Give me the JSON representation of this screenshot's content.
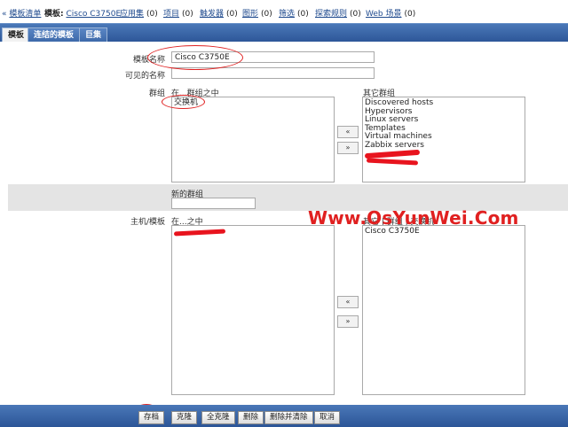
{
  "breadcrumb": {
    "template_list_link": "模板清单",
    "template_prefix": "模板:",
    "template_name_link": "Cisco C3750E",
    "applications": {
      "label": "应用集",
      "count": "(0)"
    },
    "items": {
      "label": "项目",
      "count": "(0)"
    },
    "triggers": {
      "label": "触发器",
      "count": "(0)"
    },
    "graphs": {
      "label": "图形",
      "count": "(0)"
    },
    "screens": {
      "label": "筛选",
      "count": "(0)"
    },
    "discovery": {
      "label": "探索规则",
      "count": "(0)"
    },
    "web": {
      "label": "Web 场景",
      "count": "(0)"
    }
  },
  "tabs": [
    {
      "label": "模板"
    },
    {
      "label": "连结的模板"
    },
    {
      "label": "巨集"
    }
  ],
  "form": {
    "template_name_label": "模板名称",
    "template_name_value": "Cisco C3750E",
    "visible_name_label": "可见的名称",
    "visible_name_value": "",
    "groups_label": "群组",
    "in_groups_label": "在...群组之中",
    "in_groups": [
      "交换机"
    ],
    "other_groups_label": "其它群组",
    "other_groups": [
      "Discovered hosts",
      "Hypervisors",
      "Linux servers",
      "Templates",
      "Virtual machines",
      "Zabbix servers"
    ],
    "move_left": "«",
    "move_right": "»",
    "new_group_label": "新的群组",
    "new_group_value": "",
    "hosts_label": "主机/模板",
    "in_hosts_label": "在...之中",
    "other_hosts_label": "其它 | 群组 | 交换机",
    "other_hosts": [
      "Cisco C3750E"
    ]
  },
  "watermark": "Www.OsYunWei.Com",
  "buttons": {
    "save": "存档",
    "clone": "克隆",
    "full_clone": "全克隆",
    "delete": "删除",
    "delete_and_clear": "删除并清除",
    "cancel": "取消"
  },
  "colors": {
    "accent": "#2c5597",
    "annotation": "#e02020"
  }
}
